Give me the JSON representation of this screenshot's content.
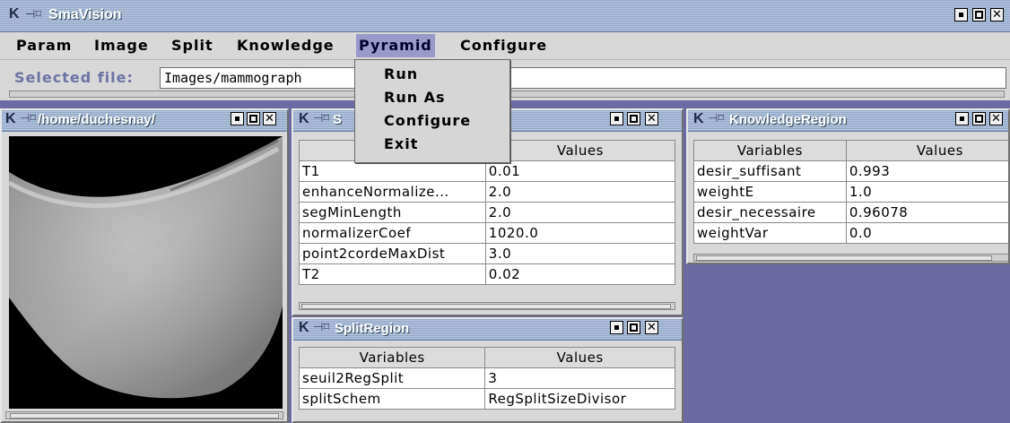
{
  "app": {
    "title": "SmaVision"
  },
  "menubar": {
    "items": [
      "Param",
      "Image",
      "Split",
      "Knowledge",
      "Pyramid",
      "Configure"
    ]
  },
  "selected_file": {
    "label": "Selected file:",
    "value": "Images/mammograph"
  },
  "pyramid_menu": {
    "items": [
      "Run",
      "Run As",
      "Configure",
      "Exit"
    ]
  },
  "image_window": {
    "title": "/home/duchesnay/"
  },
  "s_window": {
    "title": "S",
    "header_values": "Values",
    "rows": [
      {
        "name": "T1",
        "value": "0.01"
      },
      {
        "name": "enhanceNormalize...",
        "value": "2.0"
      },
      {
        "name": "segMinLength",
        "value": "2.0"
      },
      {
        "name": "normalizerCoef",
        "value": "1020.0"
      },
      {
        "name": "point2cordeMaxDist",
        "value": "3.0"
      },
      {
        "name": "T2",
        "value": "0.02"
      }
    ]
  },
  "knowledge_window": {
    "title": "KnowledgeRegion",
    "header_variables": "Variables",
    "header_values": "Values",
    "rows": [
      {
        "name": "desir_suffisant",
        "value": "0.993"
      },
      {
        "name": "weightE",
        "value": "1.0"
      },
      {
        "name": "desir_necessaire",
        "value": "0.96078"
      },
      {
        "name": "weightVar",
        "value": "0.0"
      }
    ]
  },
  "split_window": {
    "title": "SplitRegion",
    "header_variables": "Variables",
    "header_values": "Values",
    "rows": [
      {
        "name": "seuil2RegSplit",
        "value": "3"
      },
      {
        "name": "splitSchem",
        "value": "RegSplitSizeDivisor"
      }
    ]
  },
  "icons": {
    "app": "k-icon",
    "pin": "pin-icon",
    "minimize": "minimize-icon",
    "maximize": "maximize-icon",
    "close": "close-icon"
  },
  "colors": {
    "desktop": "#6b6aa3",
    "active_menu": "#9a99c9",
    "label_blue": "#6d73a3"
  }
}
